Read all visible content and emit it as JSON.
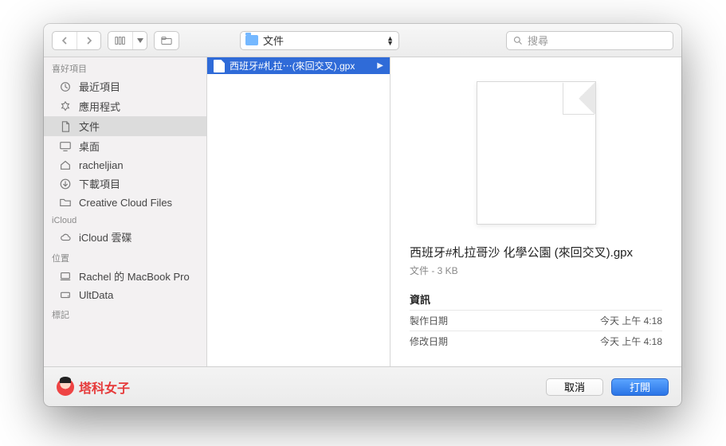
{
  "toolbar": {
    "location_label": "文件",
    "search_placeholder": "搜尋"
  },
  "sidebar": {
    "sections": [
      {
        "head": "喜好項目",
        "items": [
          {
            "icon": "clock",
            "label": "最近項目"
          },
          {
            "icon": "app",
            "label": "應用程式"
          },
          {
            "icon": "doc",
            "label": "文件",
            "selected": true
          },
          {
            "icon": "desktop",
            "label": "桌面"
          },
          {
            "icon": "home",
            "label": "racheljian"
          },
          {
            "icon": "download",
            "label": "下載項目"
          },
          {
            "icon": "folder",
            "label": "Creative Cloud Files"
          }
        ]
      },
      {
        "head": "iCloud",
        "items": [
          {
            "icon": "cloud",
            "label": "iCloud 雲碟"
          }
        ]
      },
      {
        "head": "位置",
        "items": [
          {
            "icon": "laptop",
            "label": "Rachel 的 MacBook Pro"
          },
          {
            "icon": "disk",
            "label": "UltData"
          }
        ]
      },
      {
        "head": "標記",
        "items": []
      }
    ]
  },
  "filelist": {
    "items": [
      {
        "label": "西班牙#札拉⋯(來回交叉).gpx",
        "selected": true
      }
    ]
  },
  "preview": {
    "filename": "西班牙#札拉哥沙 化學公園 (來回交叉).gpx",
    "meta": "文件 - 3 KB",
    "info_head": "資訊",
    "rows": [
      {
        "k": "製作日期",
        "v": "今天 上午 4:18"
      },
      {
        "k": "修改日期",
        "v": "今天 上午 4:18"
      }
    ]
  },
  "footer": {
    "brand": "塔科女子",
    "cancel": "取消",
    "open": "打開"
  }
}
